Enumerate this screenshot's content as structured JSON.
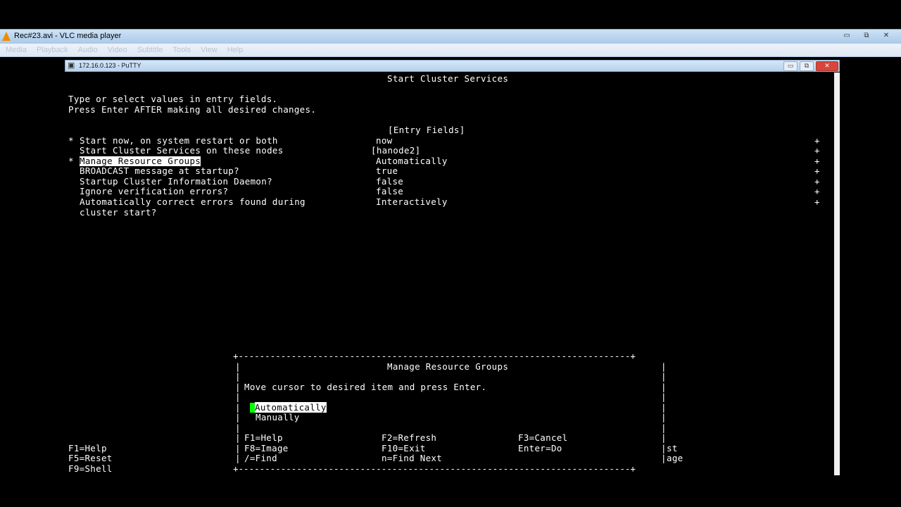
{
  "vlc": {
    "title": "Rec#23.avi - VLC media player",
    "window_buttons": [
      "▭",
      "⧉",
      "✕"
    ],
    "menu": [
      "Media",
      "Playback",
      "Audio",
      "Video",
      "Subtitle",
      "Tools",
      "View",
      "Help"
    ]
  },
  "putty": {
    "title": "172.16.0.123 - PuTTY",
    "window_buttons": [
      "▭",
      "⧉",
      "✕"
    ]
  },
  "screen": {
    "title": "Start Cluster Services",
    "intro1": "Type or select values in entry fields.",
    "intro2": "Press Enter AFTER making all desired changes.",
    "entry_fields_header": "[Entry Fields]",
    "fields": [
      {
        "mark": "*",
        "label": "Start now, on system restart or both",
        "value": "now",
        "plus": "+"
      },
      {
        "mark": "",
        "label": "Start Cluster Services on these nodes",
        "value": "[hanode2]",
        "plus": "+"
      },
      {
        "mark": "*",
        "label": "Manage Resource Groups",
        "value": "Automatically",
        "plus": "+"
      },
      {
        "mark": "",
        "label": "BROADCAST message at startup?",
        "value": "true",
        "plus": "+"
      },
      {
        "mark": "",
        "label": "Startup Cluster Information Daemon?",
        "value": "false",
        "plus": "+"
      },
      {
        "mark": "",
        "label": "Ignore verification errors?",
        "value": "false",
        "plus": "+"
      },
      {
        "mark": "",
        "label": "Automatically correct errors found during",
        "value": "Interactively",
        "plus": "+"
      }
    ],
    "field_continuation": "cluster start?",
    "footer_left": [
      "F1=Help",
      "F5=Reset",
      "F9=Shell"
    ],
    "footer_right": [
      "st",
      "age"
    ]
  },
  "popup": {
    "title": "Manage Resource Groups",
    "instruction": "Move cursor to desired item and press Enter.",
    "options": [
      "Automatically",
      "Manually"
    ],
    "keys": [
      [
        "F1=Help",
        "F2=Refresh",
        "F3=Cancel"
      ],
      [
        "F8=Image",
        "F10=Exit",
        "Enter=Do"
      ],
      [
        "/=Find",
        "n=Find Next",
        ""
      ]
    ],
    "border_top": "+--------------------------------------------------------------------------+",
    "border_side": "|"
  }
}
